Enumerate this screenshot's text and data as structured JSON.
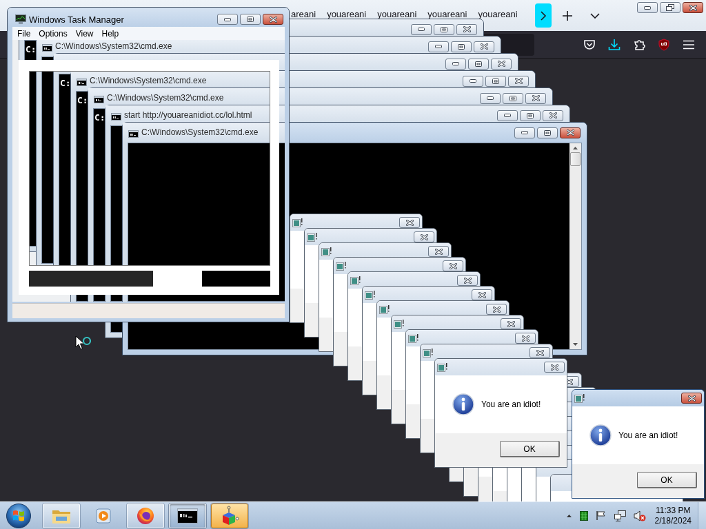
{
  "browser": {
    "active": true,
    "tabs": [
      {
        "label": "areani",
        "selected": false
      },
      {
        "label": "youareani",
        "selected": false
      },
      {
        "label": "youareani",
        "selected": false
      },
      {
        "label": "youareani",
        "selected": false
      },
      {
        "label": "youareani",
        "selected": false
      }
    ]
  },
  "console_windows": [
    {
      "active": false
    },
    {
      "active": false
    },
    {
      "active": false
    },
    {
      "active": false
    },
    {
      "active": false
    },
    {
      "active": false
    },
    {
      "active": true
    }
  ],
  "dialog_stack": [
    {
      "active": false
    },
    {
      "active": false
    },
    {
      "active": false
    },
    {
      "active": false
    },
    {
      "active": false
    },
    {
      "active": false
    },
    {
      "active": false
    },
    {
      "active": false
    },
    {
      "active": false
    },
    {
      "active": false
    }
  ],
  "alerts": [
    {
      "active": false,
      "message": "You are an idiot!",
      "button": "OK"
    },
    {
      "active": true,
      "message": "You are an idiot!",
      "button": "OK"
    }
  ],
  "task_manager": {
    "title": "Windows Task Manager",
    "active": true,
    "menu": [
      "File",
      "Options",
      "View",
      "Help"
    ],
    "ghost_windows": [
      {
        "prompt": "C:"
      },
      {
        "title": "C:\\Windows\\System32\\cmd.exe"
      },
      {
        "prompt": "C:"
      },
      {
        "title": "C:\\Windows\\System32\\cmd.exe",
        "prompt": "C:"
      },
      {
        "title": "C:\\Windows\\System32\\cmd.exe",
        "prompt": "C:"
      },
      {
        "title": "start http://youareanidiot.cc/lol.html"
      },
      {
        "title": "C:\\Windows\\System32\\cmd.exe"
      }
    ]
  },
  "taskbar": {
    "apps": [
      {
        "kind": "folder",
        "running": true,
        "selected": false,
        "flashing": false
      },
      {
        "kind": "player",
        "running": false,
        "selected": false,
        "flashing": false
      },
      {
        "kind": "browser",
        "running": true,
        "selected": false,
        "flashing": false
      },
      {
        "kind": "terminal",
        "running": true,
        "selected": true,
        "flashing": false
      },
      {
        "kind": "cube",
        "running": true,
        "selected": false,
        "flashing": true
      }
    ],
    "clock": {
      "time": "11:33 PM",
      "date": "2/18/2024"
    }
  }
}
